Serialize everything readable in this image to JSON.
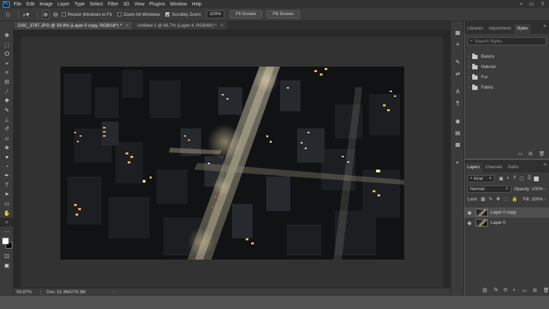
{
  "app": {
    "logo": "Ps"
  },
  "menu": [
    "File",
    "Edit",
    "Image",
    "Layer",
    "Type",
    "Select",
    "Filter",
    "3D",
    "View",
    "Plugins",
    "Window",
    "Help"
  ],
  "window_controls": {
    "search": "⌕",
    "workspace": "▭",
    "share": "⇪"
  },
  "options": {
    "resize_windows_label": "Resize Windows to Fit",
    "resize_windows_checked": false,
    "zoom_all_label": "Zoom All Windows",
    "zoom_all_checked": false,
    "scrubby_label": "Scrubby Zoom",
    "scrubby_checked": true,
    "zoom_value": "100%",
    "fit_screen_label": "Fit Screen",
    "fill_screen_label": "Fill Screen"
  },
  "tabs": [
    {
      "label": "DSC_3787.JPG @ 59.9% (Layer 0 copy, RGB/16*) *",
      "active": true
    },
    {
      "label": "Untitled-1 @ 66.7% (Layer 4, RGB/8#) *",
      "active": false
    }
  ],
  "status": {
    "zoom": "59.87%",
    "doc": "Doc: 51.9M/276.3M",
    "arrow": "›"
  },
  "libraries_panel": {
    "tabs": [
      "Libraries",
      "Adjustments",
      "Styles"
    ],
    "active_tab": "Styles",
    "search_placeholder": "Search Styles",
    "groups": [
      "Basics",
      "Natural",
      "Fur",
      "Fabric"
    ]
  },
  "layers_panel": {
    "tabs": [
      "Layers",
      "Channels",
      "Paths"
    ],
    "active_tab": "Layers",
    "kind_label": "Kind",
    "blend_mode": "Normal",
    "opacity_label": "Opacity:",
    "opacity_value": "100%",
    "lock_label": "Lock:",
    "fill_label": "Fill:",
    "fill_value": "100%",
    "layers": [
      {
        "name": "Layer 0 copy",
        "selected": true
      },
      {
        "name": "Layer 0",
        "selected": false
      }
    ]
  },
  "colors": {
    "ui_dark": "#323232",
    "ui_mid": "#3b3b3b",
    "accent": "#31a8ff",
    "foreground_swatch": "#ffffff",
    "background_swatch": "#000000"
  }
}
